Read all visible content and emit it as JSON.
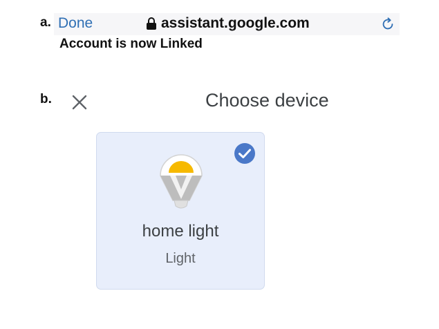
{
  "step_a": {
    "label": "a.",
    "browser": {
      "done_label": "Done",
      "url": "assistant.google.com",
      "lock_icon": "lock-icon",
      "reload_icon": "reload-icon"
    },
    "message": "Account is now Linked"
  },
  "step_b": {
    "label": "b.",
    "close_icon": "close-icon",
    "title": "Choose device",
    "device": {
      "name": "home light",
      "type": "Light",
      "selected": true,
      "icon": "light-bulb-icon"
    }
  },
  "colors": {
    "link_blue": "#2f6fb4",
    "card_background": "#e8eefb",
    "check_blue": "#4a78c8",
    "bulb_yellow": "#f6b900",
    "bulb_gray": "#bdbdbd"
  }
}
